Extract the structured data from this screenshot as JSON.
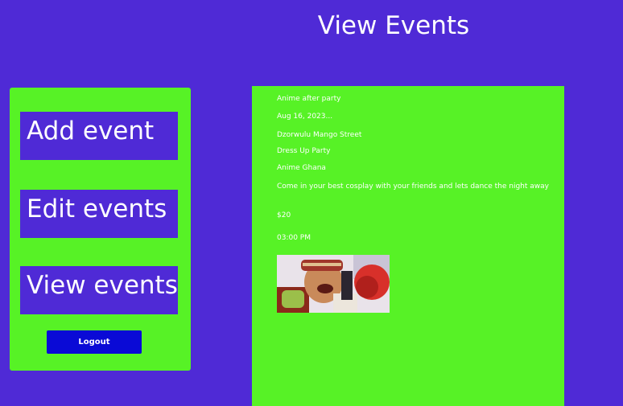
{
  "header": {
    "title": "View Events"
  },
  "sidebar": {
    "add_label": "Add event",
    "edit_label": "Edit events",
    "view_label": "View events",
    "logout_label": "Logout"
  },
  "event": {
    "title": "Anime after party",
    "date": "Aug 16, 2023...",
    "location": "Dzorwulu Mango Street",
    "type": "Dress Up Party",
    "organizer": "Anime Ghana",
    "description": "Come in your best cosplay with your friends and lets dance the night away",
    "price": "$20",
    "time": "03:00 PM"
  },
  "colors": {
    "background": "#4f2ad6",
    "panel": "#57f226",
    "logout": "#0a0ad6"
  }
}
